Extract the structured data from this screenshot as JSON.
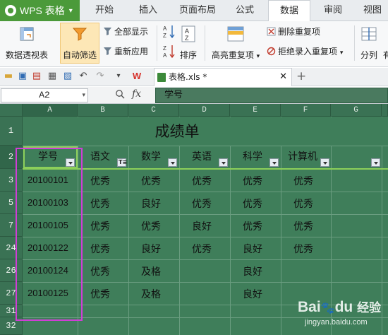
{
  "app": {
    "name": "WPS 表格"
  },
  "tabs": [
    {
      "label": "开始"
    },
    {
      "label": "插入"
    },
    {
      "label": "页面布局"
    },
    {
      "label": "公式"
    },
    {
      "label": "数据"
    },
    {
      "label": "审阅"
    },
    {
      "label": "视图"
    }
  ],
  "ribbon": {
    "pivot_label": "数据透视表",
    "autofilter_label": "自动筛选",
    "show_all_label": "全部显示",
    "reapply_label": "重新应用",
    "sort_label": "排序",
    "highlight_dup_label": "高亮重复项",
    "remove_dup_label": "删除重复项",
    "reject_dup_label": "拒绝录入重复项",
    "split_label": "分列",
    "more_label": "有"
  },
  "document": {
    "tab_title": "表格.xls *"
  },
  "formula_bar": {
    "cell_ref": "A2",
    "fx": "fx",
    "content": "学号"
  },
  "grid": {
    "columns": [
      "A",
      "B",
      "C",
      "D",
      "E",
      "F",
      "G"
    ],
    "row_numbers": [
      "1",
      "2",
      "3",
      "5",
      "7",
      "24",
      "26",
      "27",
      "31",
      "32"
    ],
    "title": "成绩单",
    "headers": [
      "学号",
      "语文",
      "数学",
      "英语",
      "科学",
      "计算机"
    ],
    "rows": [
      [
        "20100101",
        "优秀",
        "优秀",
        "优秀",
        "优秀",
        "优秀"
      ],
      [
        "20100103",
        "优秀",
        "良好",
        "优秀",
        "优秀",
        "优秀"
      ],
      [
        "20100105",
        "优秀",
        "优秀",
        "良好",
        "优秀",
        "优秀"
      ],
      [
        "20100122",
        "优秀",
        "良好",
        "优秀",
        "良好",
        "优秀"
      ],
      [
        "20100124",
        "优秀",
        "及格",
        "",
        "良好",
        ""
      ],
      [
        "20100125",
        "优秀",
        "及格",
        "",
        "良好",
        ""
      ]
    ]
  },
  "watermark": {
    "brand": "Bai",
    "paw": "du",
    "product": "经验",
    "url": "jingyan.baidu.com"
  },
  "colors": {
    "wps_green": "#4b9a3a",
    "sheet_fill": "#3f7e5a",
    "selection": "#8ccf5a",
    "annotation": "#d03ed6"
  }
}
